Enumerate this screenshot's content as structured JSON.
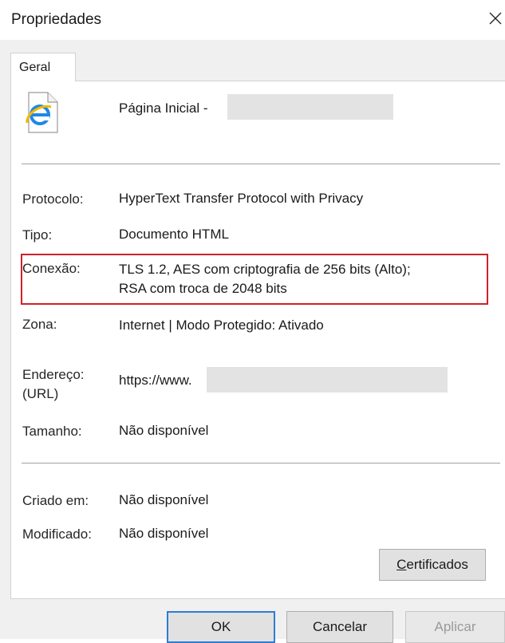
{
  "window": {
    "title": "Propriedades"
  },
  "tabs": [
    {
      "label": "Geral",
      "active": true
    }
  ],
  "header": {
    "icon": "internet-explorer-file-icon",
    "page_label": "Página Inicial -"
  },
  "properties": {
    "protocol": {
      "label": "Protocolo:",
      "value": "HyperText Transfer Protocol with Privacy"
    },
    "type": {
      "label": "Tipo:",
      "value": "Documento HTML"
    },
    "connection": {
      "label": "Conexão:",
      "value_line1": "TLS 1.2, AES com criptografia de 256 bits (Alto);",
      "value_line2": "RSA com troca de 2048 bits",
      "highlight_color": "#d0202a"
    },
    "zone": {
      "label": "Zona:",
      "value": "Internet | Modo Protegido: Ativado"
    },
    "address": {
      "label_line1": "Endereço:",
      "label_line2": "(URL)",
      "value": "https://www."
    },
    "size": {
      "label": "Tamanho:",
      "value": "Não disponível"
    },
    "created": {
      "label": "Criado em:",
      "value": "Não disponível"
    },
    "modified": {
      "label": "Modificado:",
      "value": "Não disponível"
    }
  },
  "buttons": {
    "certificates": {
      "accel": "C",
      "rest": "ertificados"
    },
    "ok": "OK",
    "cancel": "Cancelar",
    "apply": "Aplicar"
  },
  "colors": {
    "dialog_bg": "#f0f0f0",
    "panel_bg": "#ffffff",
    "default_button_border": "#2d7dd2"
  }
}
